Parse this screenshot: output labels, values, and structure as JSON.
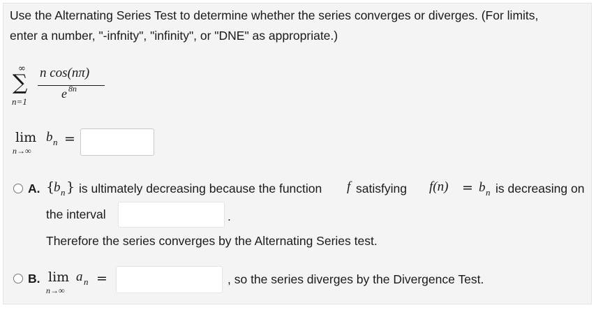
{
  "prompt": {
    "line1": "Use the Alternating Series Test to determine whether the series converges or diverges. (For limits,",
    "line2": "enter a number, \"-infnity\", \"infinity\", or \"DNE\" as appropriate.)"
  },
  "series": {
    "sum_upper": "∞",
    "sum_lower": "n=1",
    "numerator": "n cos(nπ)",
    "denominator_base": "e",
    "denominator_exp": "8n"
  },
  "limit_bn": {
    "lim": "lim",
    "sub": "n→∞",
    "var": "b",
    "var_sub": "n",
    "equals": "=",
    "value": ""
  },
  "option_a": {
    "letter": "A.",
    "seq_open": "{",
    "seq_var": "b",
    "seq_sub": "n",
    "seq_close": "}",
    "text1": "is ultimately decreasing because the function",
    "func_f": "f",
    "satisfying": "satisfying",
    "fn": "f(n)",
    "equals": "=",
    "bn": "b",
    "bn_sub": "n",
    "text2": "is decreasing on",
    "interval_label": "the interval",
    "interval_value": "",
    "period": ".",
    "conclusion": "Therefore the series converges by the Alternating Series test."
  },
  "option_b": {
    "letter": "B.",
    "lim": "lim",
    "sub": "n→∞",
    "var": "a",
    "var_sub": "n",
    "equals": "=",
    "value": "",
    "text": ", so the series diverges by the Divergence Test."
  }
}
